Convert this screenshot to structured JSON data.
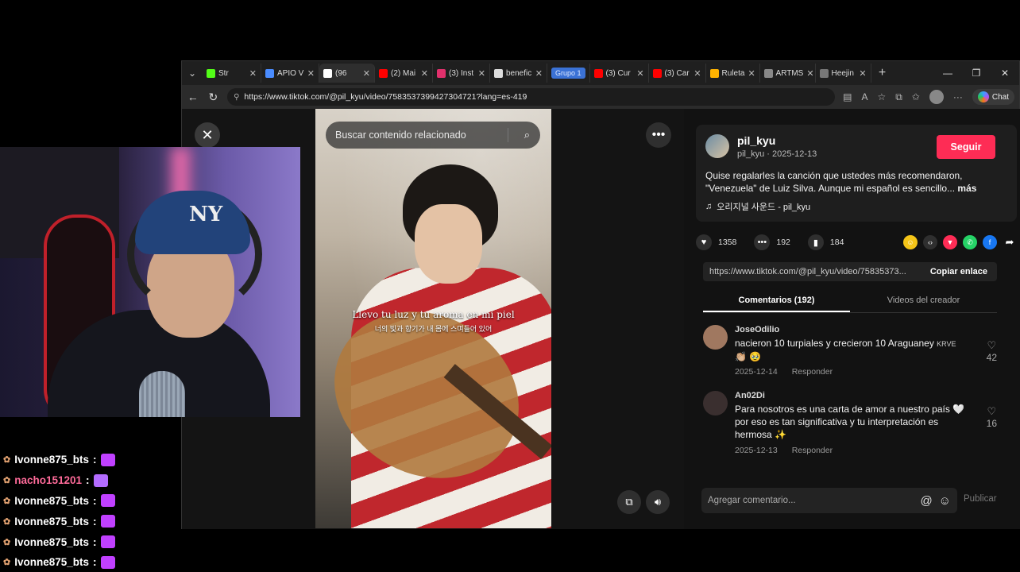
{
  "browser": {
    "tabs": [
      {
        "title": "Str",
        "color": "#53fc18",
        "active": false
      },
      {
        "title": "APIO V",
        "color": "#4a8cff",
        "active": false
      },
      {
        "title": "(96",
        "color": "#ffffff",
        "active": true
      },
      {
        "title": "(2) Mai",
        "color": "#ff0000",
        "active": false
      },
      {
        "title": "(3) Inst",
        "color": "#e1306c",
        "active": false
      },
      {
        "title": "benefic",
        "color": "#dddddd",
        "active": false
      },
      {
        "title": "(3) Cur",
        "color": "#ff0000",
        "active": false
      },
      {
        "title": "(3) Car",
        "color": "#ff0000",
        "active": false
      },
      {
        "title": "Ruleta",
        "color": "#ffb300",
        "active": false
      },
      {
        "title": "ARTMS",
        "color": "#888888",
        "active": false
      },
      {
        "title": "Heejin",
        "color": "#777777",
        "active": false
      }
    ],
    "group_label": "Grupo 1",
    "url": "https://www.tiktok.com/@pil_kyu/video/7583537399427304721?lang=es-419",
    "chat_label": "Chat"
  },
  "video": {
    "search_placeholder": "Buscar contenido relacionado",
    "lyric_es": "Llevo tu luz y tu aroma en mi piel",
    "lyric_ko": "너의 빛과 향기가 내 몸에 스며들어 있어"
  },
  "author": {
    "username": "pil_kyu",
    "subtitle": "pil_kyu · 2025-12-13",
    "follow_label": "Seguir",
    "description": "Quise regalarles la canción que ustedes más recomendaron, \"Venezuela\" de Luiz Silva. Aunque mi español es sencillo...",
    "more_label": "más",
    "music": "오리지널 사운드 - pil_kyu"
  },
  "stats": {
    "likes": "1358",
    "comments": "192",
    "saves": "184"
  },
  "share": {
    "link": "https://www.tiktok.com/@pil_kyu/video/75835373...",
    "copy_label": "Copiar enlace"
  },
  "tabs": {
    "comments": "Comentarios (192)",
    "creator": "Videos del creador"
  },
  "comments": [
    {
      "user": "JoseOdilio",
      "text": "nacieron 10 turpiales y crecieron 10 Araguaney",
      "badge": "KRVE",
      "emoji": "👏🏼 🥹",
      "date": "2025-12-14",
      "reply": "Responder",
      "likes": "42",
      "avatar_color": "#a07860"
    },
    {
      "user": "An02Di",
      "text": "Para nosotros es una carta de amor a nuestro país 🤍 por eso es tan significativa y tu interpretación es hermosa ✨",
      "badge": "",
      "emoji": "",
      "date": "2025-12-13",
      "reply": "Responder",
      "likes": "16",
      "avatar_color": "#3a2f2f"
    }
  ],
  "composer": {
    "placeholder": "Agregar comentario...",
    "publish_label": "Publicar"
  },
  "chat": [
    {
      "user": "Ivonne875_bts",
      "color": "#ffffff",
      "emote_color": "#c040ff"
    },
    {
      "user": "nacho151201",
      "color": "#ff6b9a",
      "emote_color": "#b36cff"
    },
    {
      "user": "Ivonne875_bts",
      "color": "#ffffff",
      "emote_color": "#c040ff"
    },
    {
      "user": "Ivonne875_bts",
      "color": "#ffffff",
      "emote_color": "#c040ff"
    },
    {
      "user": "Ivonne875_bts",
      "color": "#ffffff",
      "emote_color": "#c040ff"
    },
    {
      "user": "Ivonne875_bts",
      "color": "#ffffff",
      "emote_color": "#c040ff"
    }
  ],
  "chat_separator": ":"
}
